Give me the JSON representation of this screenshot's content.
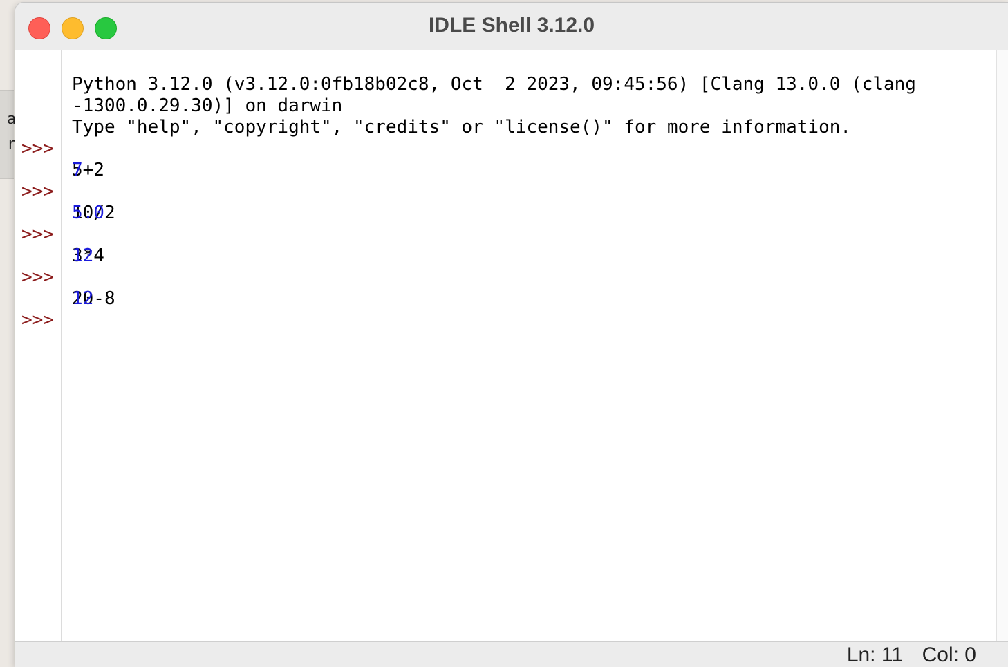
{
  "window": {
    "title": "IDLE Shell 3.12.0"
  },
  "background": {
    "fragments": [
      "a",
      "r"
    ]
  },
  "shell": {
    "banner_line1": "Python 3.12.0 (v3.12.0:0fb18b02c8, Oct  2 2023, 09:45:56) [Clang 13.0.0 (clang",
    "banner_line2": "-1300.0.29.30)] on darwin",
    "banner_line3": "Type \"help\", \"copyright\", \"credits\" or \"license()\" for more information.",
    "prompt": ">>>",
    "entries": [
      {
        "input": "5+2",
        "output": "7"
      },
      {
        "input": "10/2",
        "output": "5.0"
      },
      {
        "input": "3*4",
        "output": "12"
      },
      {
        "input": "20-8",
        "output": "12"
      }
    ]
  },
  "status": {
    "line": "Ln: 11",
    "col": "Col: 0"
  },
  "colors": {
    "prompt": "#8b1a1a",
    "output": "#1a1adb",
    "input": "#000000",
    "close": "#fe5f57",
    "minimize": "#febc2e",
    "zoom": "#28c840"
  }
}
